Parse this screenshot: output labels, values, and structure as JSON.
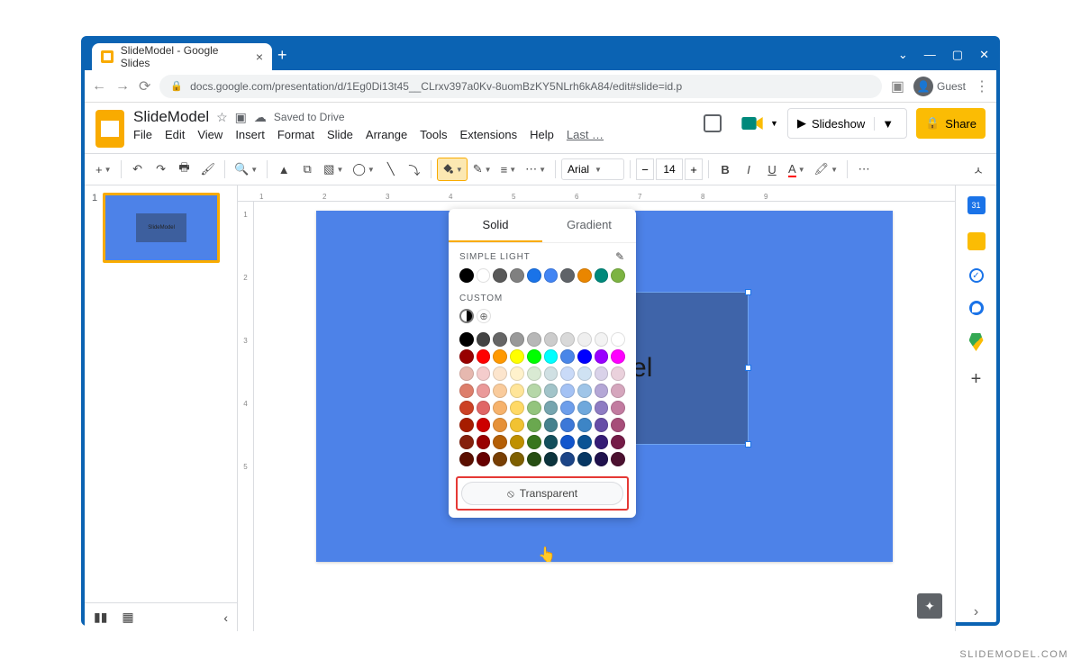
{
  "browser": {
    "tab_title": "SlideModel - Google Slides",
    "url": "docs.google.com/presentation/d/1Eg0Di13t45__CLrxv397a0Kv-8uomBzKY5NLrh6kA84/edit#slide=id.p",
    "guest_label": "Guest"
  },
  "app": {
    "doc_title": "SlideModel",
    "saved_status": "Saved to Drive",
    "menus": [
      "File",
      "Edit",
      "View",
      "Insert",
      "Format",
      "Slide",
      "Arrange",
      "Tools",
      "Extensions",
      "Help"
    ],
    "last_edit": "Last …",
    "slideshow_label": "Slideshow",
    "share_label": "Share"
  },
  "toolbar": {
    "font_name": "Arial",
    "font_size": "14"
  },
  "slide_panel": {
    "thumb_number": "1",
    "thumb_text": "SlideModel"
  },
  "canvas": {
    "shape_text": "odel"
  },
  "color_picker": {
    "tab_solid": "Solid",
    "tab_gradient": "Gradient",
    "section_theme": "SIMPLE LIGHT",
    "section_custom": "CUSTOM",
    "theme_colors": [
      "#000000",
      "#ffffff",
      "#595959",
      "#808080",
      "#1a73e8",
      "#4285f4",
      "#5f6368",
      "#ea8600",
      "#00897b",
      "#7cb342"
    ],
    "palette": [
      [
        "#000000",
        "#434343",
        "#666666",
        "#999999",
        "#b7b7b7",
        "#cccccc",
        "#d9d9d9",
        "#efefef",
        "#f3f3f3",
        "#ffffff"
      ],
      [
        "#980000",
        "#ff0000",
        "#ff9900",
        "#ffff00",
        "#00ff00",
        "#00ffff",
        "#4a86e8",
        "#0000ff",
        "#9900ff",
        "#ff00ff"
      ],
      [
        "#e6b8af",
        "#f4cccc",
        "#fce5cd",
        "#fff2cc",
        "#d9ead3",
        "#d0e0e3",
        "#c9daf8",
        "#cfe2f3",
        "#d9d2e9",
        "#ead1dc"
      ],
      [
        "#dd7e6b",
        "#ea9999",
        "#f9cb9c",
        "#ffe599",
        "#b6d7a8",
        "#a2c4c9",
        "#a4c2f4",
        "#9fc5e8",
        "#b4a7d6",
        "#d5a6bd"
      ],
      [
        "#cc4125",
        "#e06666",
        "#f6b26b",
        "#ffd966",
        "#93c47d",
        "#76a5af",
        "#6d9eeb",
        "#6fa8dc",
        "#8e7cc3",
        "#c27ba0"
      ],
      [
        "#a61c00",
        "#cc0000",
        "#e69138",
        "#f1c232",
        "#6aa84f",
        "#45818e",
        "#3c78d8",
        "#3d85c6",
        "#674ea7",
        "#a64d79"
      ],
      [
        "#85200c",
        "#990000",
        "#b45f06",
        "#bf9000",
        "#38761d",
        "#134f5c",
        "#1155cc",
        "#0b5394",
        "#351c75",
        "#741b47"
      ],
      [
        "#5b0f00",
        "#660000",
        "#783f04",
        "#7f6000",
        "#274e13",
        "#0c343d",
        "#1c4587",
        "#073763",
        "#20124d",
        "#4c1130"
      ]
    ],
    "transparent_label": "Transparent"
  },
  "watermark": "SLIDEMODEL.COM"
}
